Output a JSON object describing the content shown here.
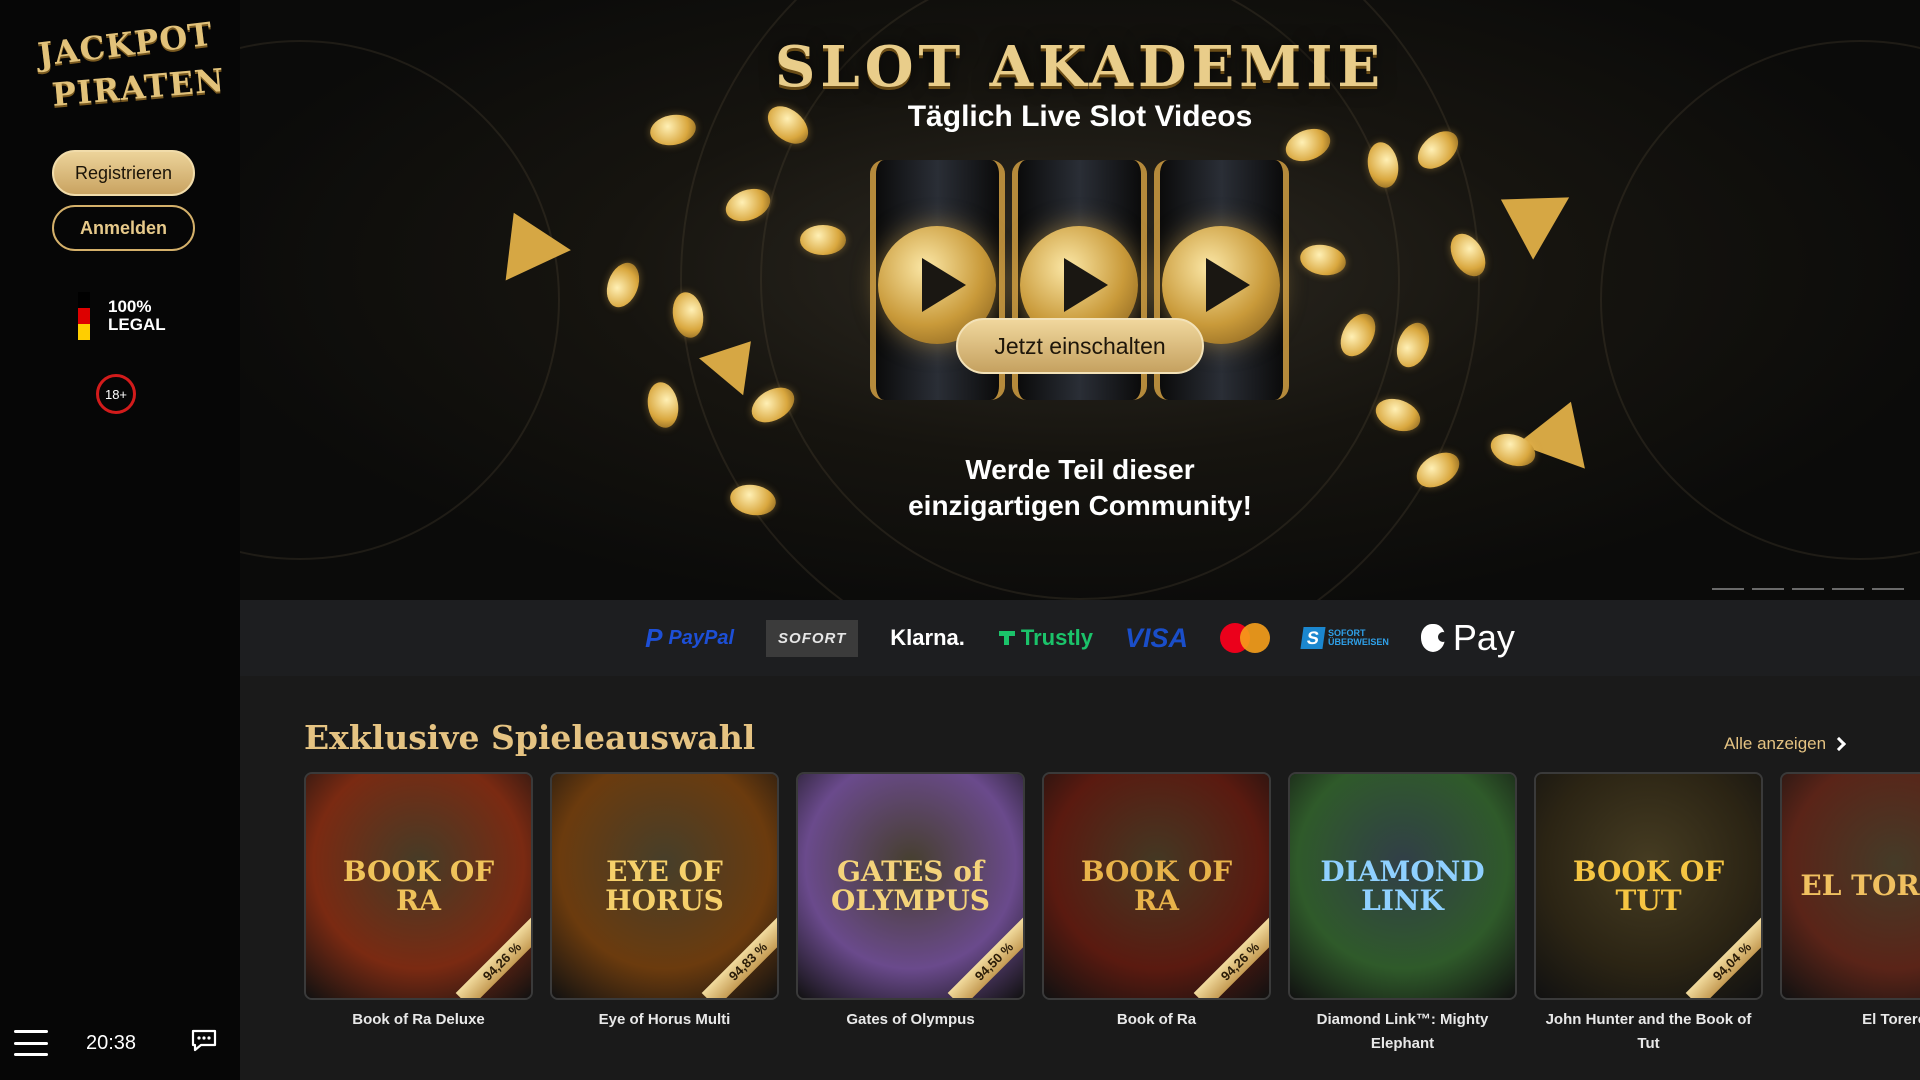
{
  "sidebar": {
    "logo_line1": "JACKPOT",
    "logo_line2": "PIRATEN",
    "register_label": "Registrieren",
    "login_label": "Anmelden",
    "legal_line1": "100%",
    "legal_line2": "LEGAL",
    "age_badge": "18+",
    "clock": "20:38",
    "flag_colors": [
      "#000000",
      "#dd0000",
      "#ffce00"
    ]
  },
  "hero": {
    "title": "SLOT AKADEMIE",
    "subtitle": "Täglich Live Slot Videos",
    "cta_label": "Jetzt einschalten",
    "tagline_line1": "Werde Teil dieser",
    "tagline_line2": "einzigartigen Community!",
    "slides_count": 5
  },
  "payments": {
    "paypal": "PayPal",
    "paypal_mark": "P",
    "sofort": "SOFORT",
    "klarna": "Klarna.",
    "trustly": "Trustly",
    "visa": "VISA",
    "sofortueberweisung_mark": "S",
    "sofortueberweisung_l1": "SOFORT",
    "sofortueberweisung_l2": "ÜBERWEISEN",
    "apple_pay": "Pay"
  },
  "games": {
    "title": "Exklusive Spieleauswahl",
    "show_all_label": "Alle anzeigen",
    "items": [
      {
        "name": "Book of Ra Deluxe",
        "rtp": "94,26 %",
        "art": "BOOK OF RA",
        "bg": "#7a2a12",
        "fg": "#f0c35a"
      },
      {
        "name": "Eye of Horus Multi",
        "rtp": "94,83 %",
        "art": "EYE OF HORUS",
        "bg": "#6b3b0e",
        "fg": "#f6d06a"
      },
      {
        "name": "Gates of Olympus",
        "rtp": "94,50 %",
        "art": "GATES of OLYMPUS",
        "bg": "#6a4a8c",
        "fg": "#f4d37a"
      },
      {
        "name": "Book of Ra",
        "rtp": "94,26 %",
        "art": "BOOK OF RA",
        "bg": "#5a1a10",
        "fg": "#e8b34a"
      },
      {
        "name": "Diamond Link™: Mighty Elephant",
        "rtp": "",
        "art": "DIAMOND LINK",
        "bg": "#2f5a2a",
        "fg": "#8fd0ff"
      },
      {
        "name": "John Hunter and the Book of Tut",
        "rtp": "94,04 %",
        "art": "BOOK OF TUT",
        "bg": "#2b2414",
        "fg": "#f5c542"
      },
      {
        "name": "El Torero",
        "rtp": "",
        "art": "EL TORERO",
        "bg": "#5a2418",
        "fg": "#f0c060"
      }
    ]
  }
}
